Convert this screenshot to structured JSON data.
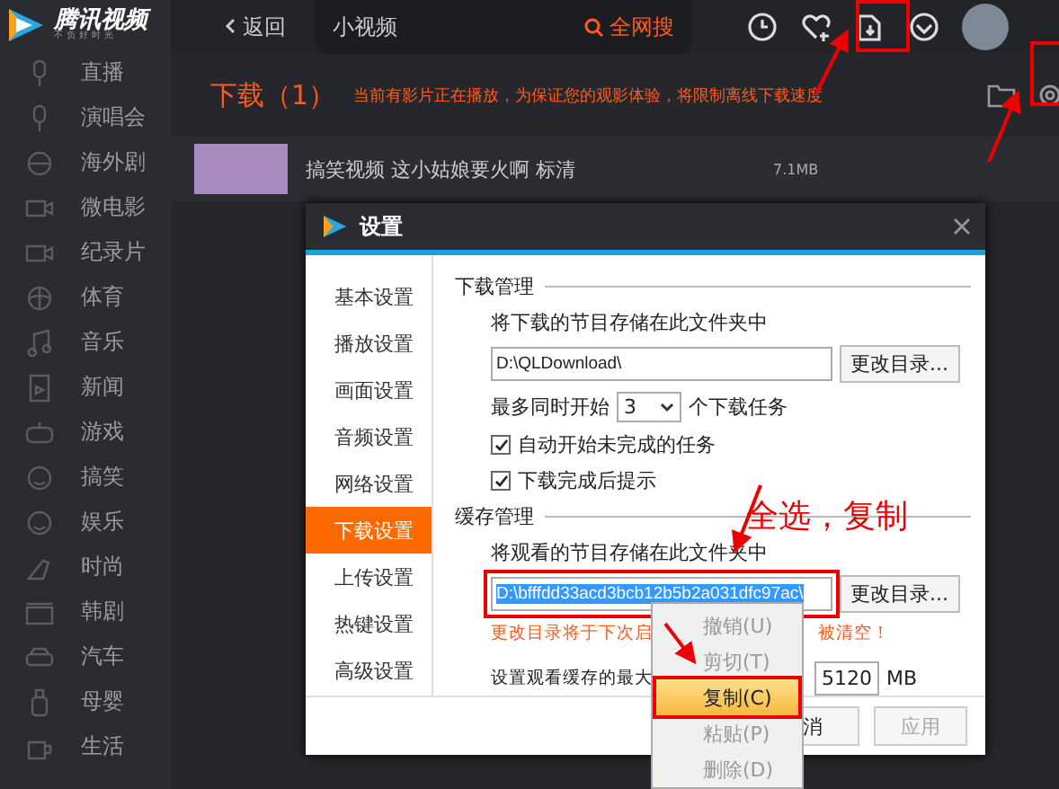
{
  "logo": {
    "title": "腾讯视频",
    "slogan": "不负好时光"
  },
  "sidebar": {
    "items": [
      {
        "label": "直播"
      },
      {
        "label": "演唱会"
      },
      {
        "label": "海外剧"
      },
      {
        "label": "微电影"
      },
      {
        "label": "纪录片"
      },
      {
        "label": "体育"
      },
      {
        "label": "音乐"
      },
      {
        "label": "新闻"
      },
      {
        "label": "游戏"
      },
      {
        "label": "搞笑"
      },
      {
        "label": "娱乐"
      },
      {
        "label": "时尚"
      },
      {
        "label": "韩剧"
      },
      {
        "label": "汽车"
      },
      {
        "label": "母婴"
      },
      {
        "label": "生活"
      }
    ]
  },
  "top_bar": {
    "back": "返回",
    "search": {
      "value": "小视频"
    },
    "search_button": "全网搜"
  },
  "downloads": {
    "title": "下载（1）",
    "notice": "当前有影片正在播放，为保证您的观影体验，将限制离线下载速度",
    "items": [
      {
        "title": "搞笑视频 这小姑娘要火啊 标清",
        "size": "7.1MB"
      }
    ]
  },
  "dialog": {
    "title": "设置",
    "nav": [
      {
        "label": "基本设置",
        "selected": false
      },
      {
        "label": "播放设置",
        "selected": false
      },
      {
        "label": "画面设置",
        "selected": false
      },
      {
        "label": "音频设置",
        "selected": false
      },
      {
        "label": "网络设置",
        "selected": false
      },
      {
        "label": "下载设置",
        "selected": true
      },
      {
        "label": "上传设置",
        "selected": false
      },
      {
        "label": "热键设置",
        "selected": false
      },
      {
        "label": "高级设置",
        "selected": false
      }
    ],
    "download_section": {
      "heading": "下载管理",
      "folder_label": "将下载的节目存储在此文件夹中",
      "folder": {
        "value": "D:\\QLDownload\\",
        "text_selected": false
      },
      "change_button": "更改目录...",
      "max_prefix": "最多同时开始",
      "max_value": "3",
      "max_suffix": "个下载任务",
      "options": [
        {
          "label": "自动开始未完成的任务",
          "checked": true
        },
        {
          "label": "下载完成后提示",
          "checked": true
        }
      ]
    },
    "cache_section": {
      "heading": "缓存管理",
      "folder_label": "将观看的节目存储在此文件夹中",
      "folder": {
        "value": "D:\\bfffdd33acd3bcb12b5b2a031dfc97ac\\",
        "text_selected": true
      },
      "change_button": "更改目录...",
      "warning_parts": [
        "更改目录将于下次启",
        "被清空！"
      ],
      "max_label": "设置观看缓存的最大",
      "max_value": "5120",
      "unit": "MB"
    },
    "buttons": [
      {
        "label": "消",
        "disabled": false
      },
      {
        "label": "应用",
        "disabled": true
      }
    ]
  },
  "context_menu": {
    "items": [
      {
        "label": "撤销(U)",
        "disabled": true,
        "selected": false
      },
      {
        "label": "剪切(T)",
        "disabled": true,
        "selected": false
      },
      {
        "label": "复制(C)",
        "disabled": false,
        "selected": true
      },
      {
        "label": "粘贴(P)",
        "disabled": true,
        "selected": false
      },
      {
        "label": "删除(D)",
        "disabled": true,
        "selected": false
      }
    ]
  },
  "annotation": {
    "text": "全选，复制"
  }
}
